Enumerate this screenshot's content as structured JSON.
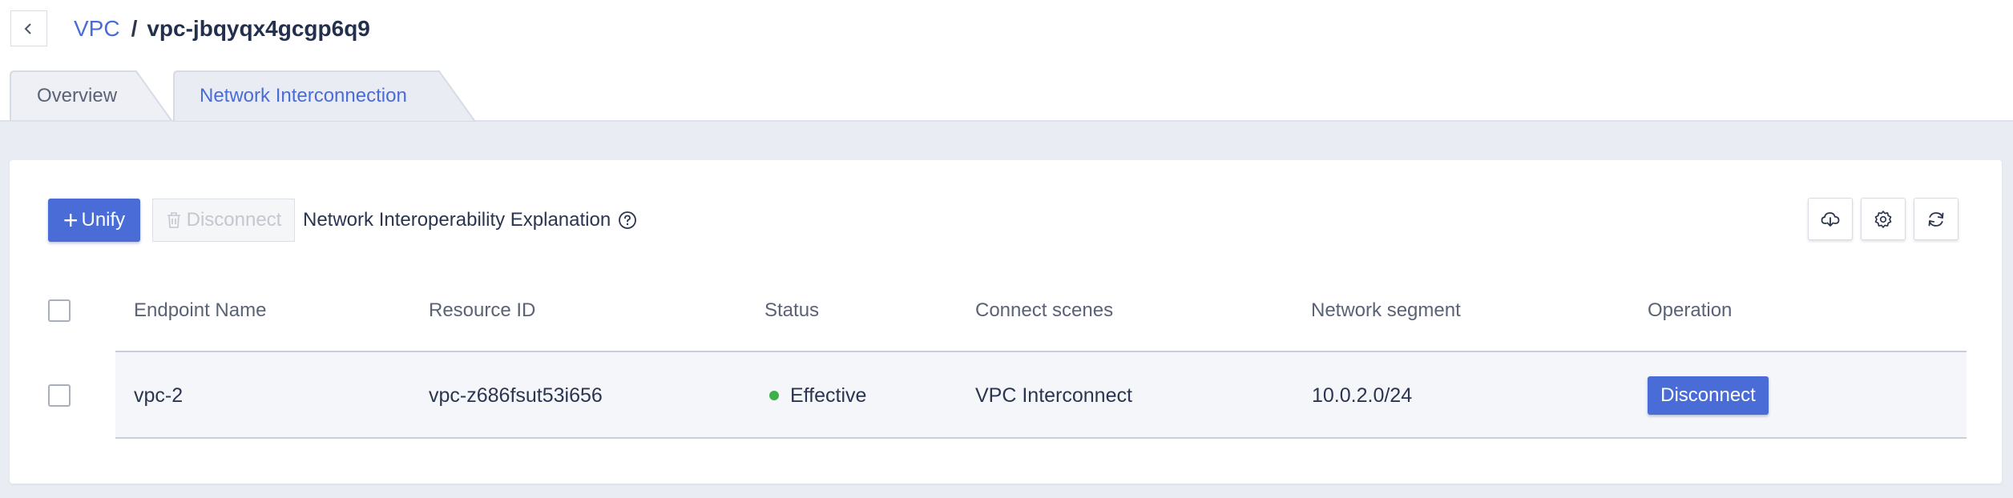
{
  "breadcrumb": {
    "parent": "VPC",
    "separator": "/",
    "current": "vpc-jbqyqx4gcgp6q9"
  },
  "tabs": [
    {
      "label": "Overview",
      "active": false
    },
    {
      "label": "Network Interconnection",
      "active": true
    }
  ],
  "toolbar": {
    "unify_label": "Unify",
    "disconnect_label": "Disconnect",
    "explanation_label": "Network Interoperability Explanation",
    "icons": [
      "cloud-download-icon",
      "settings-icon",
      "refresh-icon"
    ]
  },
  "table": {
    "columns": [
      "Endpoint Name",
      "Resource ID",
      "Status",
      "Connect scenes",
      "Network segment",
      "Operation"
    ],
    "rows": [
      {
        "endpoint_name": "vpc-2",
        "resource_id": "vpc-z686fsut53i656",
        "status": "Effective",
        "connect_scene": "VPC Interconnect",
        "network_segment": "10.0.2.0/24",
        "operation": "Disconnect"
      }
    ]
  },
  "colors": {
    "accent": "#4a6cd6",
    "status_effective": "#3cb049",
    "page_background": "#eaecf3"
  }
}
